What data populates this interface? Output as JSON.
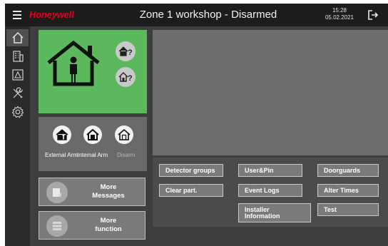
{
  "header": {
    "brand": "Honeywell",
    "title": "Zone 1 workshop - Disarmed",
    "time": "15:28",
    "date": "05.02.2021",
    "menu_icon": "hamburger-menu-icon",
    "logout_icon": "logout-icon"
  },
  "sidebar": {
    "items": [
      {
        "icon": "home-icon",
        "active": true
      },
      {
        "icon": "building-icon",
        "active": false
      },
      {
        "icon": "floorplan-icon",
        "active": false
      },
      {
        "icon": "tools-icon",
        "active": false
      },
      {
        "icon": "gear-icon",
        "active": false
      }
    ]
  },
  "status": {
    "state_icon": "person-in-house-icon",
    "query_icons": [
      "house-question-icon",
      "house-question-icon"
    ],
    "color": "#5cb85c"
  },
  "arm_controls": [
    {
      "label": "External Arm",
      "icon": "external-arm-icon",
      "enabled": true
    },
    {
      "label": "Internal Arm",
      "icon": "internal-arm-icon",
      "enabled": true
    },
    {
      "label": "Disarm",
      "icon": "disarm-icon",
      "enabled": false
    }
  ],
  "more": {
    "messages_line1": "More",
    "messages_line2": "Messages",
    "function_line1": "More",
    "function_line2": "function"
  },
  "actions": {
    "detector_groups": "Detector groups",
    "user_pin": "User&Pin",
    "doorguards": "Doorguards",
    "clear_part": "Clear part.",
    "event_logs": "Event Logs",
    "alter_times": "Alter Times",
    "installer_line1": "Installer",
    "installer_line2": "Information",
    "test": "Test"
  },
  "colors": {
    "brand": "#e3001b",
    "topbar": "#1c1c1c",
    "background": "#3e3e3e"
  }
}
